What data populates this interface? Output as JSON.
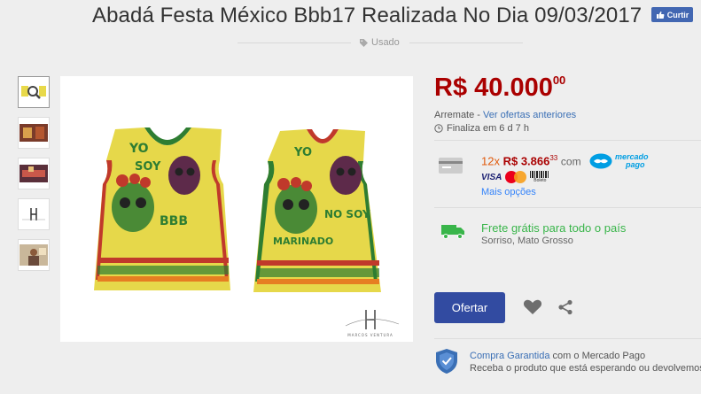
{
  "title": "Abadá Festa México Bbb17 Realizada No Dia 09/03/2017",
  "facebook": {
    "label": "Curtir",
    "icon": "thumbs-up-icon"
  },
  "condition": {
    "label": "Usado",
    "icon": "tag-icon"
  },
  "thumbnails": [
    {
      "icon": "jersey-thumbnail-zoom"
    },
    {
      "icon": "photo-thumbnail"
    },
    {
      "icon": "photo-thumbnail"
    },
    {
      "icon": "logo-thumbnail"
    },
    {
      "icon": "person-thumbnail"
    }
  ],
  "main_image": {
    "left_text_1": "YO",
    "left_text_2": "SOY",
    "left_text_3": "BBB",
    "right_text_1": "YO",
    "right_text_2": "NO SOY",
    "right_text_3": "MARINADO",
    "watermark": "MARCOS VENTURA"
  },
  "price": {
    "main": "R$ 40.000",
    "cents": "00"
  },
  "arremate": {
    "label": "Arremate - ",
    "link": "Ver ofertas anteriores"
  },
  "finaliza": {
    "label": "Finaliza em 6 d 7 h",
    "icon": "clock-icon"
  },
  "payment": {
    "installments": "12x",
    "amount": "R$ 3.866",
    "cents": "33",
    "with": "com",
    "mp_line1": "mercado",
    "mp_line2": "pago",
    "visa": "VISA",
    "boleto": "Boleto",
    "more_options": "Mais opções",
    "icon": "credit-card-icon"
  },
  "shipping": {
    "label": "Frete grátis para todo o país",
    "location": "Sorriso, Mato Grosso",
    "icon": "truck-icon"
  },
  "actions": {
    "offer_label": "Ofertar"
  },
  "guarantee": {
    "link": "Compra Garantida",
    "rest": " com o Mercado Pago",
    "line2": "Receba o produto que está esperando ou devolvemos o"
  },
  "colors": {
    "price": "#aa0000",
    "installments": "#e05a0c",
    "link": "#3a6fb5",
    "free_shipping": "#39b54a",
    "offer_button": "#324ba1"
  }
}
